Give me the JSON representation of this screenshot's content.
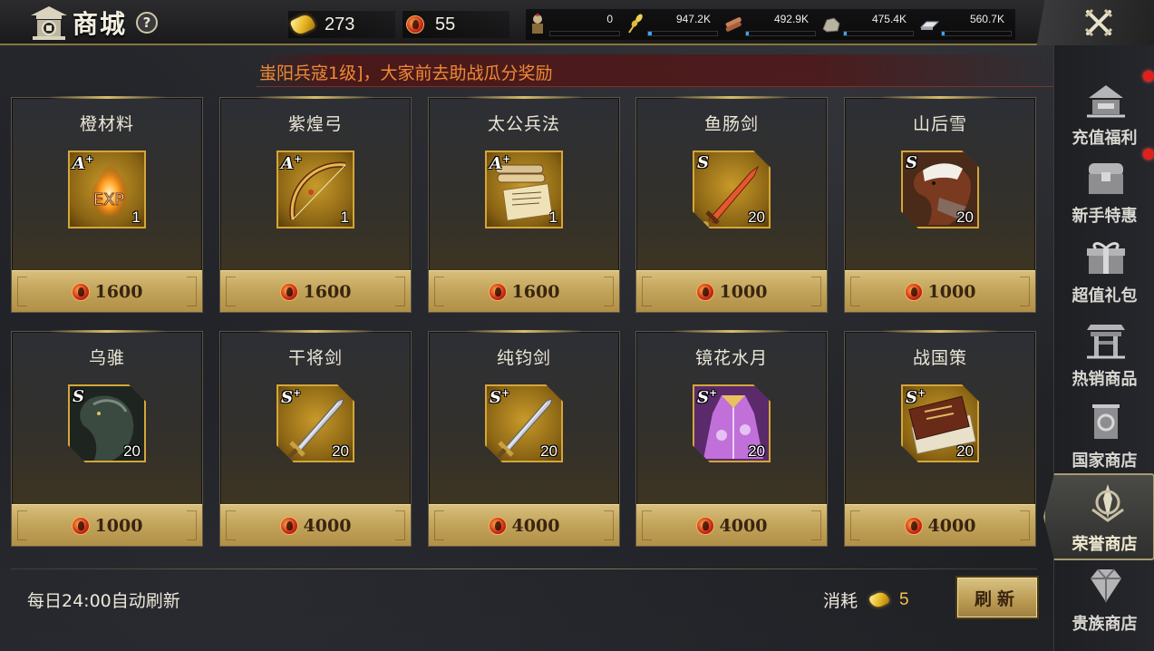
{
  "header": {
    "title": "商城",
    "help": "?",
    "gold": "273",
    "honor_coins": "55",
    "resources": [
      {
        "icon": "soldier-icon",
        "value": "0",
        "fill": 0
      },
      {
        "icon": "grain-icon",
        "value": "947.2K",
        "fill": 0.05
      },
      {
        "icon": "wood-icon",
        "value": "492.9K",
        "fill": 0.03
      },
      {
        "icon": "stone-icon",
        "value": "475.4K",
        "fill": 0.03
      },
      {
        "icon": "iron-icon",
        "value": "560.7K",
        "fill": 0.04
      }
    ]
  },
  "marquee": "蚩阳兵寇1级]，大家前去助战瓜分奖励",
  "items": [
    {
      "name": "橙材料",
      "grade": "A",
      "plus": "+",
      "qty": "1",
      "price": "1600",
      "icon": "exp-flame-icon"
    },
    {
      "name": "紫煌弓",
      "grade": "A",
      "plus": "+",
      "qty": "1",
      "price": "1600",
      "icon": "bow-icon"
    },
    {
      "name": "太公兵法",
      "grade": "A",
      "plus": "+",
      "qty": "1",
      "price": "1600",
      "icon": "scroll-icon"
    },
    {
      "name": "鱼肠剑",
      "grade": "S",
      "plus": "",
      "qty": "20",
      "price": "1000",
      "icon": "dagger-icon"
    },
    {
      "name": "山后雪",
      "grade": "S",
      "plus": "",
      "qty": "20",
      "price": "1000",
      "icon": "white-horse-icon"
    },
    {
      "name": "乌骓",
      "grade": "S",
      "plus": "",
      "qty": "20",
      "price": "1000",
      "icon": "black-horse-icon"
    },
    {
      "name": "干将剑",
      "grade": "S",
      "plus": "+",
      "qty": "20",
      "price": "4000",
      "icon": "sword-icon"
    },
    {
      "name": "纯钧剑",
      "grade": "S",
      "plus": "+",
      "qty": "20",
      "price": "4000",
      "icon": "sword-icon"
    },
    {
      "name": "镜花水月",
      "grade": "S",
      "plus": "+",
      "qty": "20",
      "price": "4000",
      "icon": "robe-icon"
    },
    {
      "name": "战国策",
      "grade": "S",
      "plus": "+",
      "qty": "20",
      "price": "4000",
      "icon": "book-icon"
    }
  ],
  "footer": {
    "refresh_note": "每日24:00自动刷新",
    "cost_label": "消耗",
    "cost_value": "5",
    "refresh_button": "刷新"
  },
  "sidebar": [
    {
      "label": "充值福利",
      "icon": "recharge-icon",
      "dot": true,
      "active": false
    },
    {
      "label": "新手特惠",
      "icon": "chest-icon",
      "dot": true,
      "active": false
    },
    {
      "label": "超值礼包",
      "icon": "gift-icon",
      "dot": false,
      "active": false
    },
    {
      "label": "热销商品",
      "icon": "shop-gate-icon",
      "dot": false,
      "active": false
    },
    {
      "label": "国家商店",
      "icon": "banner-icon",
      "dot": false,
      "active": false
    },
    {
      "label": "荣誉商店",
      "icon": "honor-icon",
      "dot": false,
      "active": true
    },
    {
      "label": "贵族商店",
      "icon": "diamond-icon",
      "dot": false,
      "active": false
    }
  ]
}
